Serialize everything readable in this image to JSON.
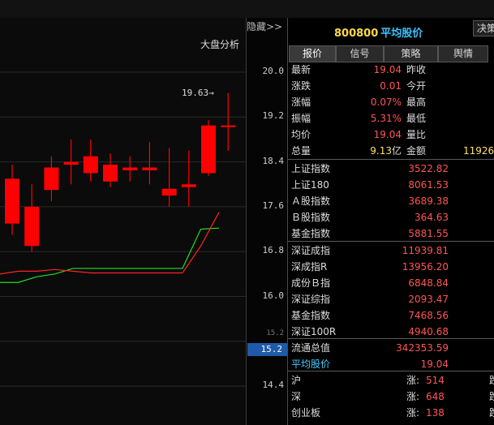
{
  "toolbar": {
    "hide_label": "隐藏>>",
    "decide_label": "决策"
  },
  "stock": {
    "code": "800800",
    "name": "平均股价"
  },
  "chart_label": "大盘分析",
  "high_marker": "19.63→",
  "tabs": [
    {
      "label": "报价",
      "active": true
    },
    {
      "label": "信号",
      "active": false
    },
    {
      "label": "策略",
      "active": false
    },
    {
      "label": "舆情",
      "active": false
    }
  ],
  "quote": [
    {
      "label": "最新",
      "value": "19.04",
      "label2": "昨收"
    },
    {
      "label": "涨跌",
      "value": "0.01",
      "label2": "今开"
    },
    {
      "label": "涨幅",
      "value": "0.07%",
      "label2": "最高"
    },
    {
      "label": "振幅",
      "value": "5.31%",
      "label2": "最低"
    },
    {
      "label": "均价",
      "value": "19.04",
      "label2": "量比"
    },
    {
      "label": "总量",
      "value": "9.13",
      "unit": "亿",
      "label2": "金额",
      "value2": "11926"
    }
  ],
  "indices_sh": [
    {
      "label": "上证指数",
      "value": "3522.82"
    },
    {
      "label": "上证180",
      "value": "8061.53"
    },
    {
      "label": "Ａ股指数",
      "value": "3689.38"
    },
    {
      "label": "Ｂ股指数",
      "value": "364.63"
    },
    {
      "label": "基金指数",
      "value": "5881.55"
    }
  ],
  "indices_sz": [
    {
      "label": "深证成指",
      "value": "11939.81"
    },
    {
      "label": "深成指R",
      "value": "13956.20"
    },
    {
      "label": "成份Ｂ指",
      "value": "6848.84"
    },
    {
      "label": "深证综指",
      "value": "2093.47"
    },
    {
      "label": "基金指数",
      "value": "7468.56"
    },
    {
      "label": "深证100R",
      "value": "4940.68"
    }
  ],
  "totals": [
    {
      "label": "流通总值",
      "value": "342353.59"
    },
    {
      "label": "平均股价",
      "value": "19.04"
    }
  ],
  "breadth": [
    {
      "label": "沪",
      "up_label": "涨:",
      "up": "514",
      "down_label": "跌"
    },
    {
      "label": "深",
      "up_label": "涨:",
      "up": "648",
      "down_label": "跌"
    },
    {
      "label": "创业板",
      "up_label": "涨:",
      "up": "138",
      "down_label": "跌"
    }
  ],
  "price_tag": "15.2",
  "chart_data": {
    "type": "candlestick",
    "title": "",
    "y_ticks": [
      "20.0",
      "19.2",
      "18.4",
      "17.6",
      "16.8",
      "16.0",
      "15.2",
      "14.4"
    ],
    "ylim": [
      14.2,
      20.2
    ],
    "colors": {
      "up": "#ff0000",
      "ma_short": "#ff2222",
      "ma_long": "#22dd22"
    },
    "candles": [
      {
        "open": 17.3,
        "close": 18.1,
        "high": 18.35,
        "low": 17.1
      },
      {
        "open": 17.6,
        "close": 16.9,
        "high": 18.0,
        "low": 16.8
      },
      {
        "open": 17.9,
        "close": 18.3,
        "high": 18.5,
        "low": 17.7
      },
      {
        "open": 18.35,
        "close": 18.4,
        "high": 18.8,
        "low": 18.0
      },
      {
        "open": 18.2,
        "close": 18.5,
        "high": 18.8,
        "low": 18.05
      },
      {
        "open": 18.05,
        "close": 18.35,
        "high": 18.55,
        "low": 17.95
      },
      {
        "open": 18.25,
        "close": 18.3,
        "high": 18.5,
        "low": 18.05
      },
      {
        "open": 18.25,
        "close": 18.3,
        "high": 18.75,
        "low": 18.0
      },
      {
        "open": 17.8,
        "close": 17.92,
        "high": 18.65,
        "low": 17.6
      },
      {
        "open": 17.95,
        "close": 18.0,
        "high": 18.6,
        "low": 17.6
      },
      {
        "open": 18.2,
        "close": 19.05,
        "high": 19.15,
        "low": 18.15
      },
      {
        "open": 19.04,
        "close": 19.05,
        "high": 19.63,
        "low": 18.6
      }
    ],
    "ma_long": [
      16.25,
      16.25,
      16.35,
      16.4,
      16.5,
      16.5,
      16.5,
      16.5,
      16.5,
      16.5,
      16.5,
      17.2,
      17.22
    ],
    "ma_short": [
      16.4,
      16.45,
      16.45,
      16.48,
      16.45,
      16.42,
      16.42,
      16.42,
      16.42,
      16.42,
      16.42,
      16.9,
      17.5
    ]
  }
}
